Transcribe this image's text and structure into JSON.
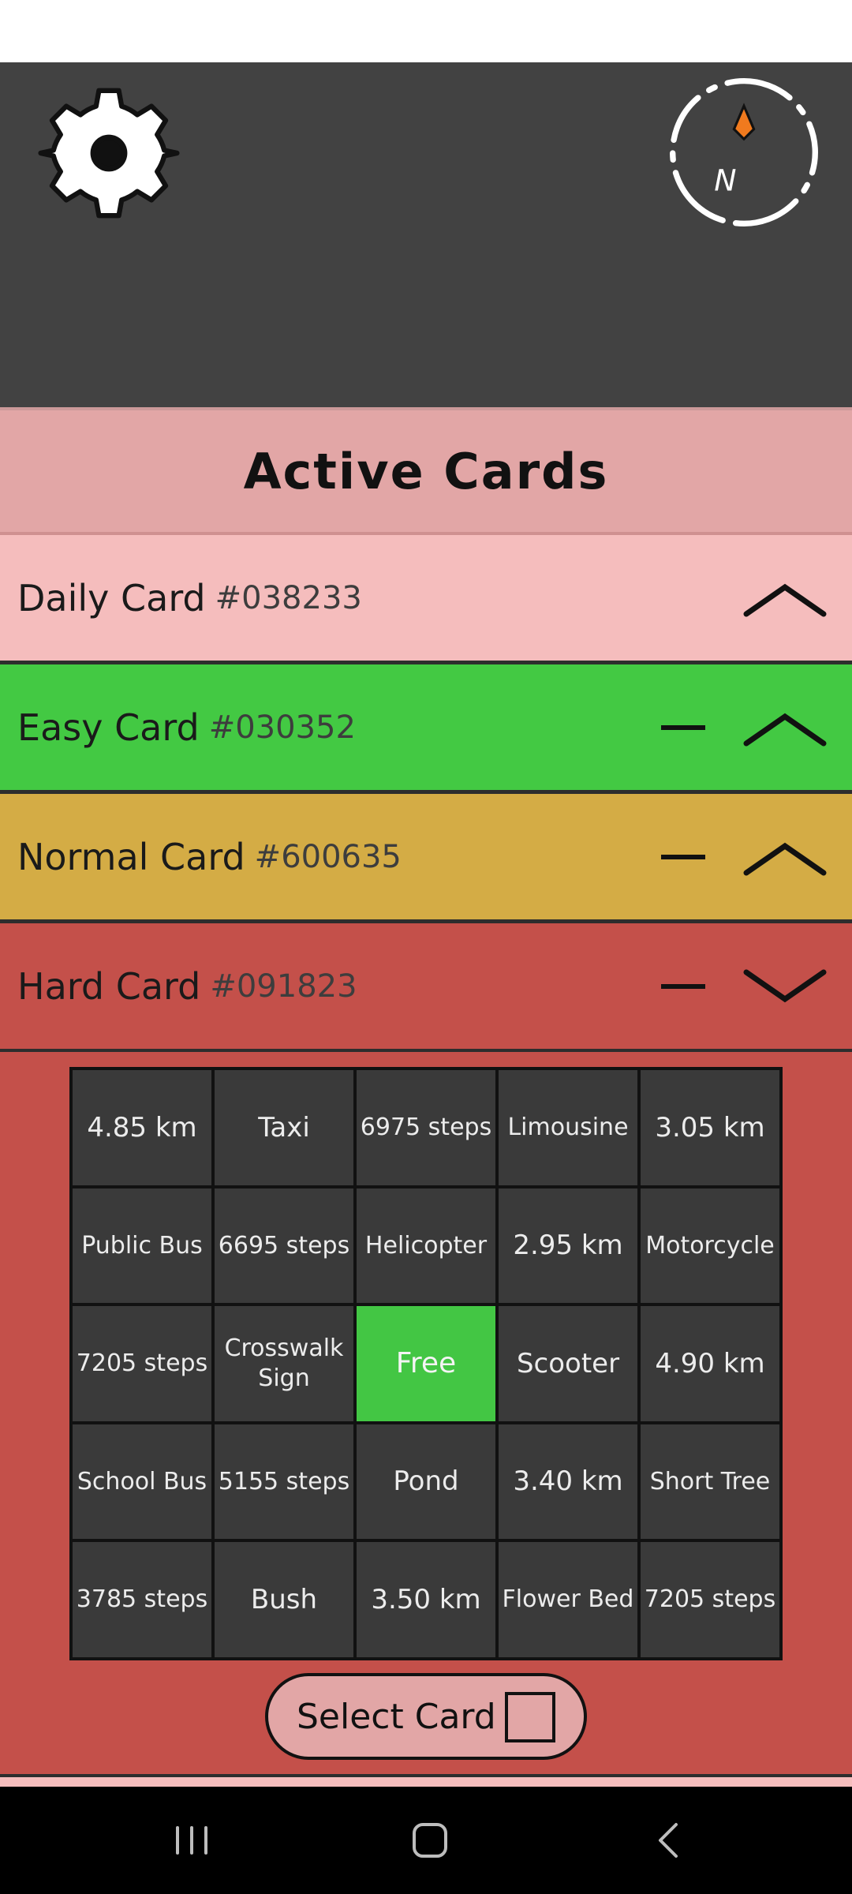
{
  "header": {
    "icons": [
      "gear-icon",
      "compass-icon"
    ],
    "compass_letter": "N",
    "compass_needle_color": "#f07a1e"
  },
  "active_cards": {
    "title": "Active Cards"
  },
  "cards": [
    {
      "name": "Daily Card",
      "number": "#038233",
      "color": "#f5bdbd",
      "expanded": false,
      "removable": false
    },
    {
      "name": "Easy Card",
      "number": "#030352",
      "color": "#43c943",
      "expanded": false,
      "removable": true
    },
    {
      "name": "Normal Card",
      "number": "#600635",
      "color": "#d4ac45",
      "expanded": false,
      "removable": true
    },
    {
      "name": "Hard Card",
      "number": "#091823",
      "color": "#c4504a",
      "expanded": true,
      "removable": true
    }
  ],
  "bingo_grid": [
    [
      "4.85 km",
      "Taxi",
      "6975 steps",
      "Limousine",
      "3.05 km"
    ],
    [
      "Public Bus",
      "6695 steps",
      "Helicopter",
      "2.95 km",
      "Motorcycle"
    ],
    [
      "7205 steps",
      "Crosswalk Sign",
      "Free",
      "Scooter",
      "4.90 km"
    ],
    [
      "School Bus",
      "5155 steps",
      "Pond",
      "3.40 km",
      "Short Tree"
    ],
    [
      "3785 steps",
      "Bush",
      "3.50 km",
      "Flower Bed",
      "7205 steps"
    ]
  ],
  "free_cell_color": "#43c644",
  "select_card": {
    "label": "Select Card",
    "checked": false
  },
  "nav": {
    "icons": [
      "recent-apps-icon",
      "home-icon",
      "back-icon"
    ]
  }
}
